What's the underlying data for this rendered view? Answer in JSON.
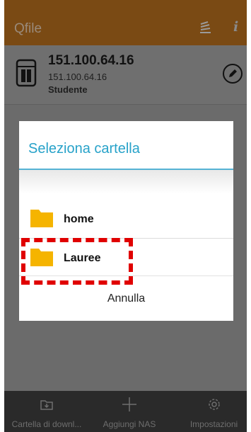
{
  "appbar": {
    "title": "Qfile",
    "stack_icon": "stack-icon",
    "info_icon": "info-icon",
    "info_glyph": "i"
  },
  "nas": {
    "name": "151.100.64.16",
    "ip": "151.100.64.16",
    "user": "Studente",
    "icon": "nas-device-icon",
    "edit_icon": "edit-pencil-icon"
  },
  "dialog": {
    "title": "Seleziona cartella",
    "folders": [
      {
        "label": "home",
        "icon": "folder-icon"
      },
      {
        "label": "Lauree",
        "icon": "folder-icon",
        "highlighted": true
      }
    ],
    "cancel_label": "Annulla"
  },
  "bottombar": {
    "items": [
      {
        "label": "Cartella di downl...",
        "icon": "download-folder-icon"
      },
      {
        "label": "Aggiungi NAS",
        "icon": "plus-icon"
      },
      {
        "label": "Impostazioni",
        "icon": "gear-icon"
      }
    ]
  },
  "colors": {
    "appbar": "#7a4a14",
    "dialog_accent": "#27a2c9",
    "folder": "#f5b400",
    "highlight": "#e00000"
  }
}
